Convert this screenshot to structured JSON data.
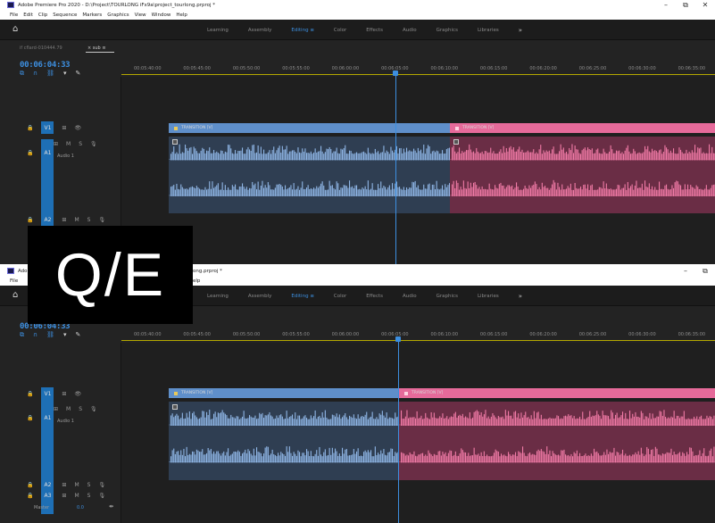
{
  "top": {
    "window_title": "Adobe Premiere Pro 2020 - D:\\Project\\TOURLONG iFx9a\\project_tourlong.prproj *",
    "menu": [
      "File",
      "Edit",
      "Clip",
      "Sequence",
      "Markers",
      "Graphics",
      "View",
      "Window",
      "Help"
    ],
    "workspaces": [
      "Learning",
      "Assembly",
      "Editing",
      "Color",
      "Effects",
      "Audio",
      "Graphics",
      "Libraries"
    ],
    "sequence_tab": "if cflard-010444.79",
    "sequence_tab_active": "× sub ≡",
    "timecode": "00:06:04:33",
    "ruler": [
      "00:05:40:00",
      "00:05:45:00",
      "00:05:50:00",
      "00:05:55:00",
      "00:06:00:00",
      "00:06:05:00",
      "00:06:10:00",
      "00:06:15:00",
      "00:06:20:00",
      "00:06:25:00",
      "00:06:30:00",
      "00:06:35:00"
    ],
    "track_row_v1": [
      "V1",
      "⊞",
      "👁"
    ],
    "track_row_a1": [
      "A1",
      "M",
      "S",
      "🎙"
    ],
    "track_row_a2": [
      "A2",
      "M",
      "S",
      "🎙"
    ],
    "audio_name": "Audio 1",
    "clip_blue_label": "TRANSITION [V]",
    "clip_pink_label": "TRANSITION [V]"
  },
  "bottom": {
    "window_title_visible": "ong.prproj *",
    "menu_visible_fragment": "elp",
    "menu_left_fragment": "File",
    "title_left_fragment": "Ado",
    "workspaces": [
      "Learning",
      "Assembly",
      "Editing",
      "Color",
      "Effects",
      "Audio",
      "Graphics",
      "Libraries"
    ],
    "timecode": "00:06:04:33",
    "ruler": [
      "00:05:40:00",
      "00:05:45:00",
      "00:05:50:00",
      "00:05:55:00",
      "00:06:00:00",
      "00:06:05:00",
      "00:06:10:00",
      "00:06:15:00",
      "00:06:20:00",
      "00:06:25:00",
      "00:06:30:00",
      "00:06:35:00"
    ],
    "audio_name": "Audio 1",
    "master_label": "Master",
    "master_value": "0.0",
    "clip_blue_label": "TRANSITION [V]",
    "clip_pink_label": "TRANSITION [V]"
  },
  "overlay_text": "Q/E",
  "colors": {
    "accent_blue": "#3d8fe0",
    "clip_blue": "#5f8fca",
    "clip_pink": "#e66a9a",
    "panel_bg": "#232323"
  },
  "icons": {
    "home": "home-icon",
    "snap": "snap-magnet-icon",
    "linked": "linked-selection-icon",
    "marker": "add-marker-icon",
    "wrench": "settings-wrench-icon"
  }
}
